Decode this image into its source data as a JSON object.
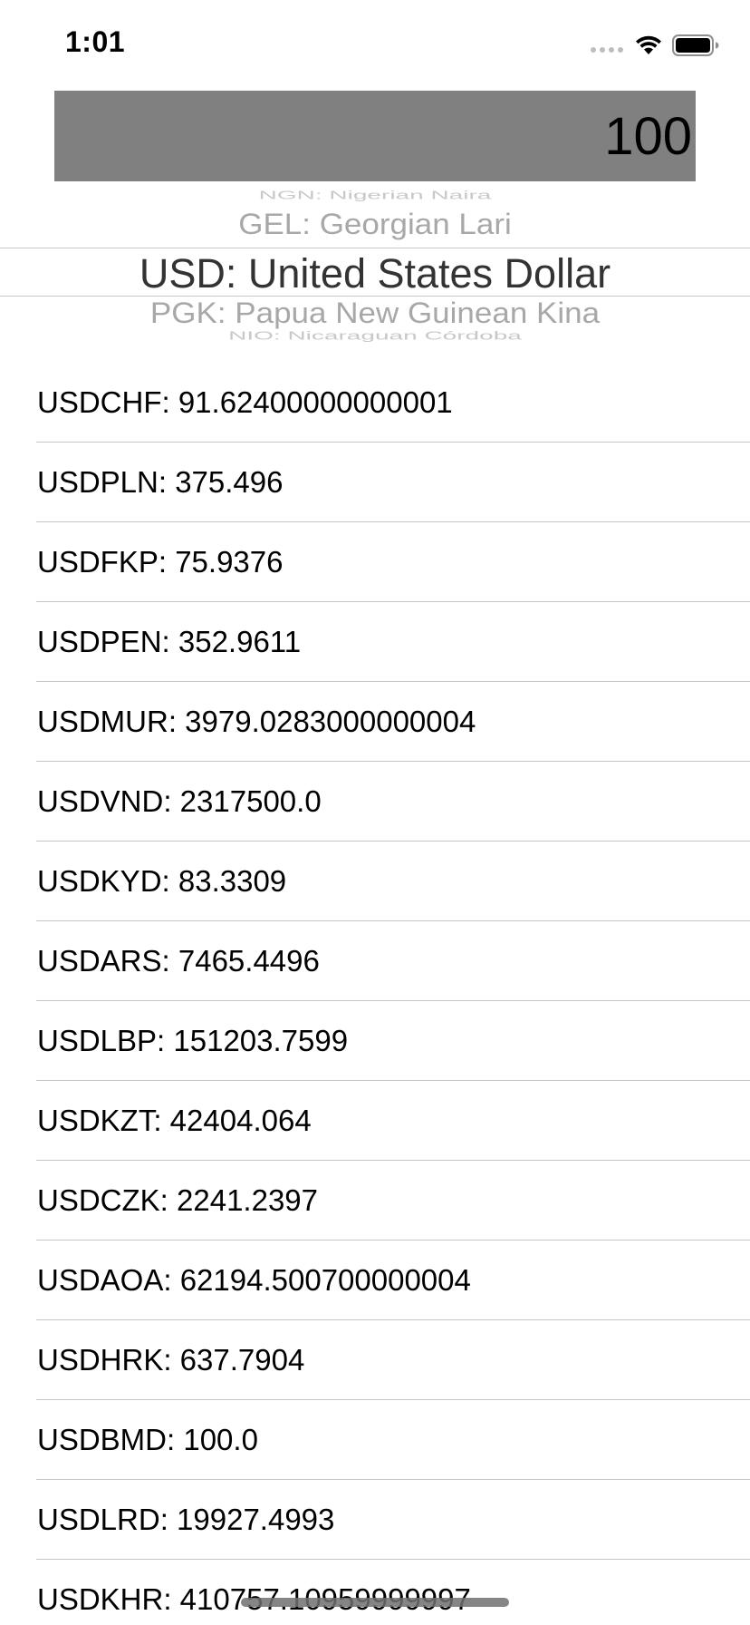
{
  "status_bar": {
    "time": "1:01",
    "signal_icon": "cellular-signal-icon",
    "wifi_icon": "wifi-icon",
    "battery_icon": "battery-icon"
  },
  "amount_field": {
    "value": "100",
    "background": "#808080"
  },
  "currency_picker": {
    "far_above": "NGN: Nigerian Naira",
    "above": "GEL: Georgian Lari",
    "selected": "USD: United States Dollar",
    "below": "PGK: Papua New Guinean Kina",
    "far_below": "NIO: Nicaraguan Córdoba"
  },
  "rates": [
    "USDCHF: 91.62400000000001",
    "USDPLN: 375.496",
    "USDFKP: 75.9376",
    "USDPEN: 352.9611",
    "USDMUR: 3979.0283000000004",
    "USDVND: 2317500.0",
    "USDKYD: 83.3309",
    "USDARS: 7465.4496",
    "USDLBP: 151203.7599",
    "USDKZT: 42404.064",
    "USDCZK: 2241.2397",
    "USDAOA: 62194.500700000004",
    "USDHRK: 637.7904",
    "USDBMD: 100.0",
    "USDLRD: 19927.4993",
    "USDKHR: 410757.10959999997"
  ]
}
